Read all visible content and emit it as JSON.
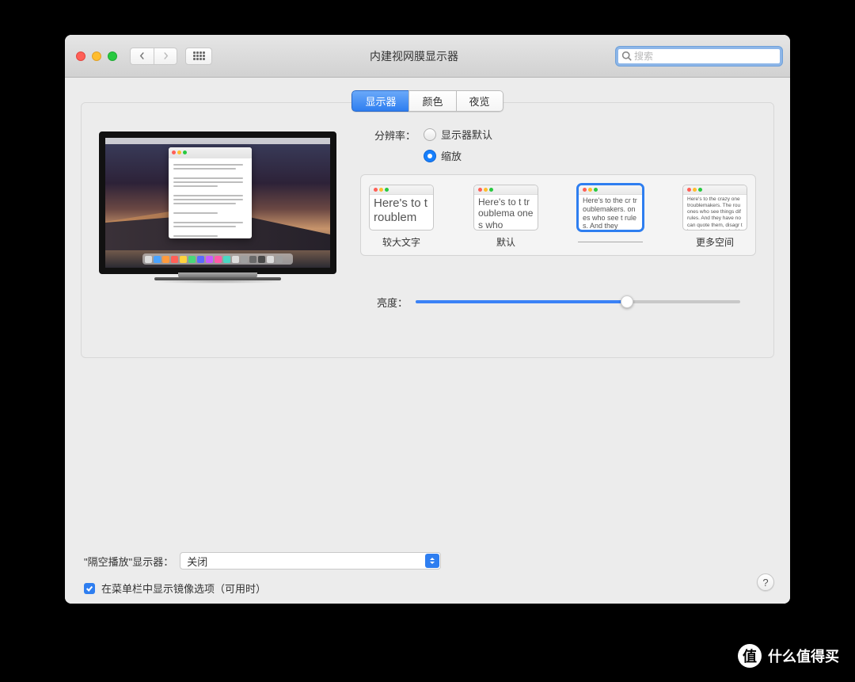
{
  "window_title": "内建视网膜显示器",
  "search_placeholder": "搜索",
  "tabs": [
    "显示器",
    "颜色",
    "夜览"
  ],
  "active_tab": 0,
  "resolution": {
    "label": "分辨率：",
    "options": [
      "显示器默认",
      "缩放"
    ],
    "selected": 1
  },
  "scaled": {
    "thumb_text": {
      "xl": "Here's to troublem",
      "l": "Here's to t troublema ones who",
      "m": "Here's to the cr troublemakers. ones who see t rules. And they",
      "s": "Here's to the crazy one troublemakers. The rou ones who see things dif rules. And they have no can quote them, disagr them. About the only thi Because they change t"
    },
    "labels": [
      "较大文字",
      "默认",
      "",
      "更多空间"
    ],
    "selected": 2
  },
  "brightness": {
    "label": "亮度：",
    "value_pct": 65
  },
  "airplay": {
    "label": "\"隔空播放\"显示器：",
    "value": "关闭"
  },
  "checkbox_label": "在菜单栏中显示镜像选项（可用时）",
  "checkbox_checked": true,
  "help": "?",
  "watermark": "什么值得买",
  "dock_colors": [
    "#dcdcdc",
    "#4aa3ff",
    "#ff9a3d",
    "#ff5f57",
    "#ffd23d",
    "#4ad77a",
    "#5b6bff",
    "#c95bff",
    "#ff5ba7",
    "#4ad7c3",
    "#dcdcdc",
    "#9f9f9f",
    "#6a6a6a",
    "#4a4a4a",
    "#dcdcdc",
    "#9f9f9f"
  ]
}
